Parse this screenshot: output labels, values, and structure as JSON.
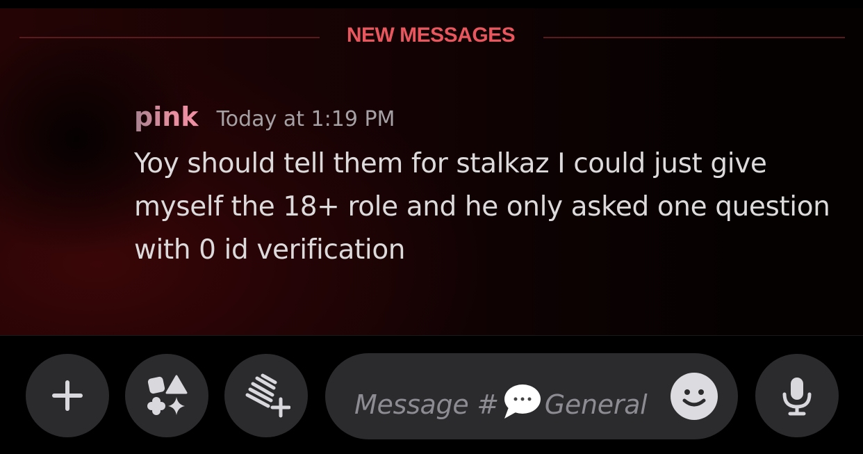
{
  "divider": {
    "label": "NEW MESSAGES",
    "color": "#e8565e"
  },
  "message": {
    "username": "pink",
    "timestamp": "Today at 1:19 PM",
    "text": "Yoy should tell them for stalkaz I could just give myself the 18+ role and he only asked one question with 0 id verification"
  },
  "composer": {
    "placeholder_prefix": "Message #",
    "channel_icon": "speech-bubble-emoji",
    "channel_name": "General",
    "buttons": {
      "attach": "plus-icon",
      "apps": "apps-icon",
      "gift": "gift-icon",
      "emoji": "emoji-smile-icon",
      "voice": "microphone-icon"
    }
  },
  "colors": {
    "background": "#000000",
    "chat_bg_accent": "#3a0607",
    "button_bg": "#2b2b2e",
    "username": "#e88ea0",
    "message_text": "#dddadb"
  }
}
